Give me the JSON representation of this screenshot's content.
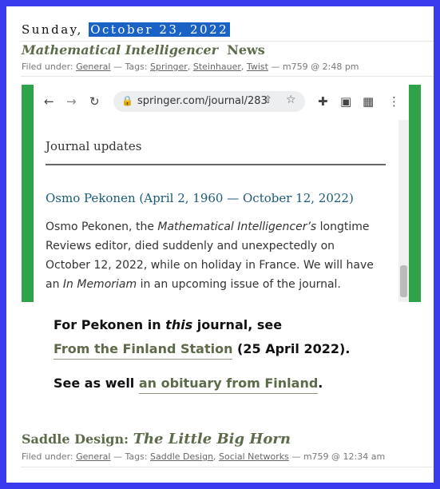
{
  "post1": {
    "day": "Sunday,",
    "date": "October 23, 2022",
    "title_italic": "Mathematical Intelligencer",
    "title_rest": "News",
    "filed_label": "Filed under:",
    "category": "General",
    "tags_label": "— Tags:",
    "tags": [
      "Springer",
      "Steinhauer",
      "Twist"
    ],
    "byline": "— m759 @ 2:48 pm"
  },
  "browser": {
    "url": "springer.com/journal/283",
    "icons": [
      "back-arrow-icon",
      "forward-arrow-icon",
      "reload-icon",
      "lock-icon",
      "share-icon",
      "star-icon",
      "extensions-icon",
      "sidebar-icon",
      "extension-grid-icon",
      "more-icon"
    ],
    "section_heading": "Journal updates",
    "obituary_title": "Osmo Pekonen (April 2, 1960 — October 12, 2022)",
    "body_1": "Osmo Pekonen, the ",
    "body_italic_1": "Mathematical Intelligencer’s",
    "body_2": " longtime Reviews editor, died suddenly and unexpectedly on October 12, 2022, while on holiday in France. We will have an ",
    "body_italic_2": "In Memoriam",
    "body_3": " in an upcoming issue of the journal."
  },
  "note": {
    "line1_a": "For Pekonen in ",
    "line1_italic": "this",
    "line1_b": " journal, see",
    "link1": "From the Finland Station",
    "line2_rest": " (25 April 2022).",
    "line3_a": "See as well ",
    "link2": "an obituary from Finland",
    "line3_end": "."
  },
  "post2": {
    "title_plain": "Saddle Design:",
    "title_italic": "The Little Big Horn",
    "filed_label": "Filed under:",
    "category": "General",
    "tags_label": "— Tags:",
    "tags": [
      "Saddle Design",
      "Social Networks"
    ],
    "byline": "— m759 @ 12:34 am"
  },
  "colors": {
    "page_border": "#3a3aee",
    "date_highlight": "#1a63c5",
    "title_green": "#5c6b4a",
    "screenshot_green": "#2ea34a",
    "obituary_blue": "#1a5a7a"
  }
}
